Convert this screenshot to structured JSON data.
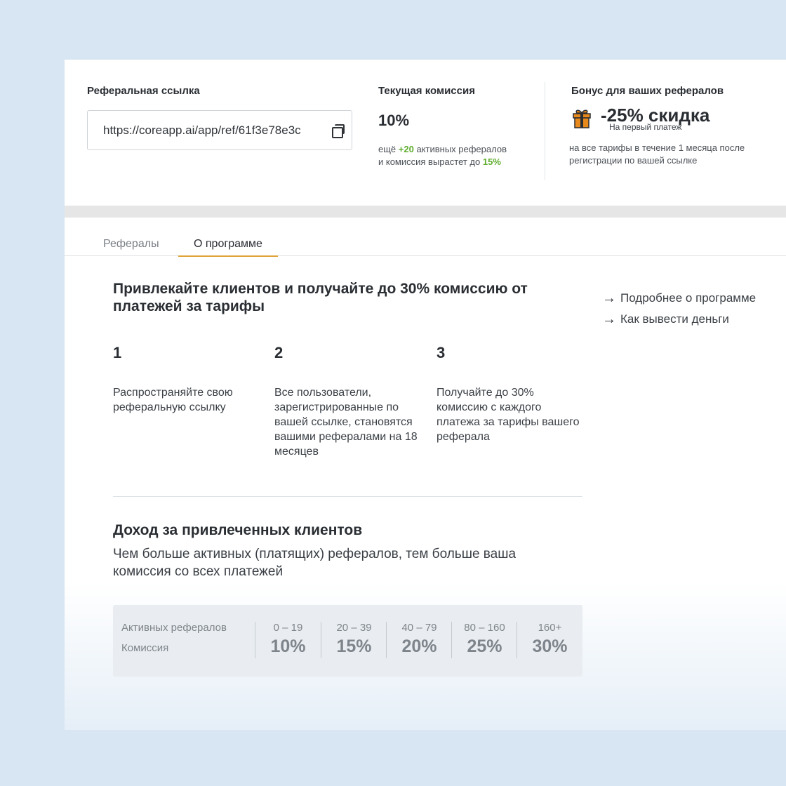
{
  "referral": {
    "label": "Реферальная ссылка",
    "url": "https://coreapp.ai/app/ref/61f3e78e3c"
  },
  "commission": {
    "label": "Текущая комиссия",
    "value": "10%",
    "note_prefix": "ещё ",
    "note_count": "+20",
    "note_middle": " активных рефералов и комиссия вырастет до ",
    "note_target": "15%"
  },
  "bonus": {
    "label": "Бонус для ваших рефералов",
    "value": "-25% скидка",
    "subtitle": "На первый платеж",
    "note": "на все тарифы в течение 1 месяца после регистрации по вашей ссылке"
  },
  "tabs": [
    {
      "label": "Рефералы",
      "active": false
    },
    {
      "label": "О программе",
      "active": true
    }
  ],
  "program": {
    "title": "Привлекайте клиентов и получайте до 30% комиссию от платежей за тарифы",
    "links": [
      {
        "label": "Подробнее о программе"
      },
      {
        "label": "Как вывести деньги"
      }
    ],
    "steps": [
      {
        "num": "1",
        "text": "Распространяйте свою реферальную ссылку"
      },
      {
        "num": "2",
        "text": "Все пользователи, зарегистрированные по вашей ссылке, становятся вашими рефералами на 18 месяцев"
      },
      {
        "num": "3",
        "text": "Получайте до 30% комиссию с каждого платежа за тарифы вашего реферала"
      }
    ]
  },
  "income": {
    "title": "Доход за привлеченных клиентов",
    "description": "Чем больше активных (платящих) рефералов, тем больше ваша комиссия со всех платежей",
    "table": {
      "row1_label": "Активных рефералов",
      "row2_label": "Комиссия",
      "tiers": [
        {
          "range": "0 – 19",
          "pct": "10%"
        },
        {
          "range": "20 – 39",
          "pct": "15%"
        },
        {
          "range": "40 – 79",
          "pct": "20%"
        },
        {
          "range": "80 – 160",
          "pct": "25%"
        },
        {
          "range": "160+",
          "pct": "30%"
        }
      ]
    }
  },
  "colors": {
    "accent_green": "#5fae2e",
    "tab_underline": "#e0a33a",
    "gift_orange": "#e8891c"
  }
}
